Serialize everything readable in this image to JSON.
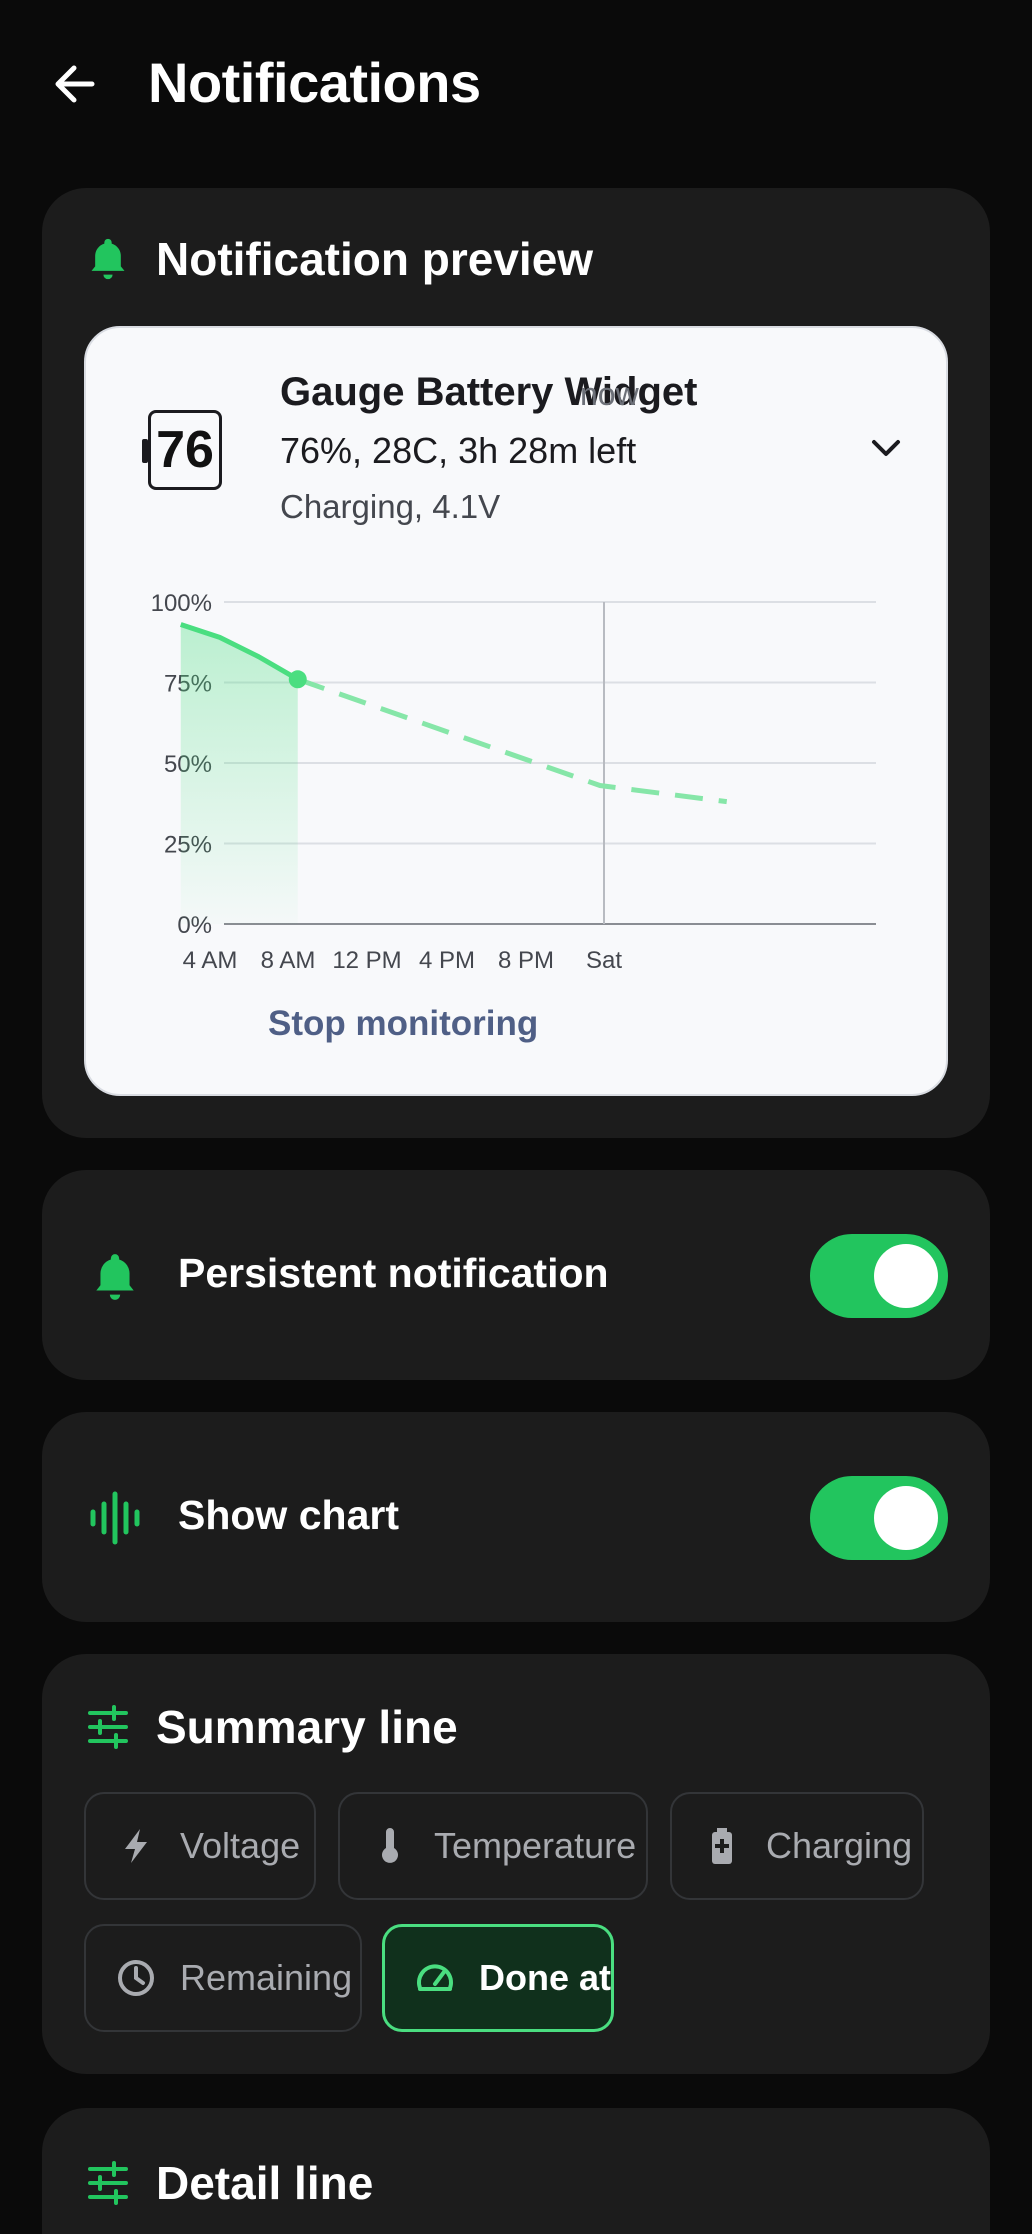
{
  "header": {
    "title": "Notifications"
  },
  "preview": {
    "section_title": "Notification preview",
    "icon_value": "76",
    "app_name": "Gauge Battery Widget",
    "time": "now",
    "line1": "76%, 28C, 3h 28m left",
    "line2": "Charging, 4.1V",
    "action": "Stop monitoring"
  },
  "persistent": {
    "label": "Persistent notification",
    "enabled": true
  },
  "show_chart": {
    "label": "Show chart",
    "enabled": true
  },
  "summary": {
    "title": "Summary line",
    "chips": [
      {
        "label": "Voltage",
        "icon": "bolt-icon",
        "active": false
      },
      {
        "label": "Temperature",
        "icon": "thermometer-icon",
        "active": false
      },
      {
        "label": "Charging",
        "icon": "battery-charging-icon",
        "active": false
      },
      {
        "label": "Remaining",
        "icon": "clock-icon",
        "active": false
      },
      {
        "label": "Done at",
        "icon": "speedometer-icon",
        "active": true
      }
    ]
  },
  "detail": {
    "title": "Detail line"
  },
  "colors": {
    "accent": "#22c55e",
    "accent_light": "#4ade80",
    "background": "#0a0a0a",
    "card": "#1c1c1c"
  },
  "chart_data": {
    "type": "line",
    "y_ticks": [
      "100%",
      "75%",
      "50%",
      "25%",
      "0%"
    ],
    "x_ticks": [
      "4 AM",
      "8 AM",
      "12 PM",
      "4 PM",
      "8 PM",
      "Sat"
    ],
    "ylim": [
      0,
      100
    ],
    "series": [
      {
        "style": "solid-area",
        "points": [
          [
            2.5,
            93
          ],
          [
            4.5,
            89
          ],
          [
            6.5,
            83
          ],
          [
            8.5,
            76
          ]
        ]
      },
      {
        "style": "dashed-prediction",
        "points": [
          [
            8.5,
            76
          ],
          [
            24,
            43
          ],
          [
            30.5,
            38
          ]
        ]
      }
    ],
    "marker": [
      8.5,
      76
    ],
    "vertical_line_at": "Sat"
  }
}
